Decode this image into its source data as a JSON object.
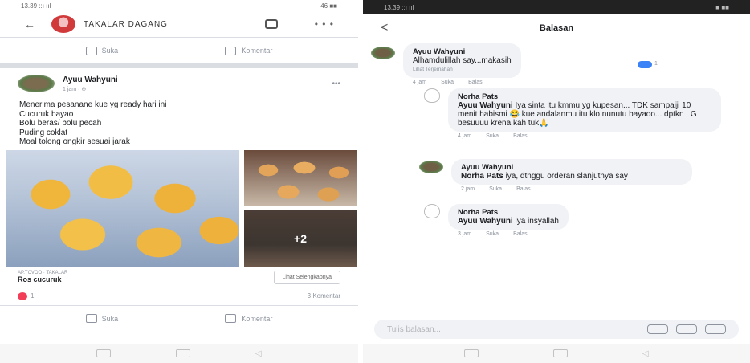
{
  "left": {
    "status": {
      "time": "13.39 ::ı ııl",
      "right": "46 ■■"
    },
    "group_name": "TAKALAR DAGANG",
    "top_actions": {
      "like": "Suka",
      "comment": "Komentar"
    },
    "post": {
      "author": "Ayuu Wahyuni",
      "time": "1 jam · ⊕",
      "lines": [
        "Menerima pesanane kue yg ready hari ini",
        "Cucuruk bayao",
        "Bolu beras/ bolu pecah",
        "Puding coklat",
        "Moal tolong ongkir sesuai jarak"
      ],
      "extra_photos": "+2",
      "link_domain": "AP.TCVOO · TAKALAR",
      "link_title": "Ros cucuruk",
      "link_button": "Lihat Selengkapnya",
      "reaction_count": "1",
      "comment_count": "3 Komentar"
    },
    "bottom_actions": {
      "like": "Suka",
      "comment": "Komentar"
    }
  },
  "right": {
    "status": {
      "time": "13.39 ::ı ııl",
      "right": "■ ■■"
    },
    "title": "Balasan",
    "comments": [
      {
        "name": "Ayuu Wahyuni",
        "text": "Alhamdulillah say...makasih",
        "sub": "Lihat Terjemahan",
        "time": "4 jam",
        "like": "Suka",
        "reply": "Balas",
        "reactions": "1"
      },
      {
        "name": "Norha Pats",
        "tag": "Ayuu Wahyuni",
        "text": "Iya sinta itu kmmu yg kupesan... TDK sampaiji 10 menit habismi 😂 kue andalanmu itu klo nunutu bayaoo... dptkn LG besuuuu krena kah tuk🙏",
        "time": "4 jam",
        "like": "Suka",
        "reply": "Balas"
      },
      {
        "name": "Ayuu Wahyuni",
        "tag": "Norha Pats",
        "text": "iya, dtnggu orderan slanjutnya say",
        "time": "2 jam",
        "like": "Suka",
        "reply": "Balas"
      },
      {
        "name": "Norha Pats",
        "tag": "Ayuu Wahyuni",
        "text": "iya insyallah",
        "time": "3 jam",
        "like": "Suka",
        "reply": "Balas"
      }
    ],
    "input_placeholder": "Tulis balasan..."
  }
}
